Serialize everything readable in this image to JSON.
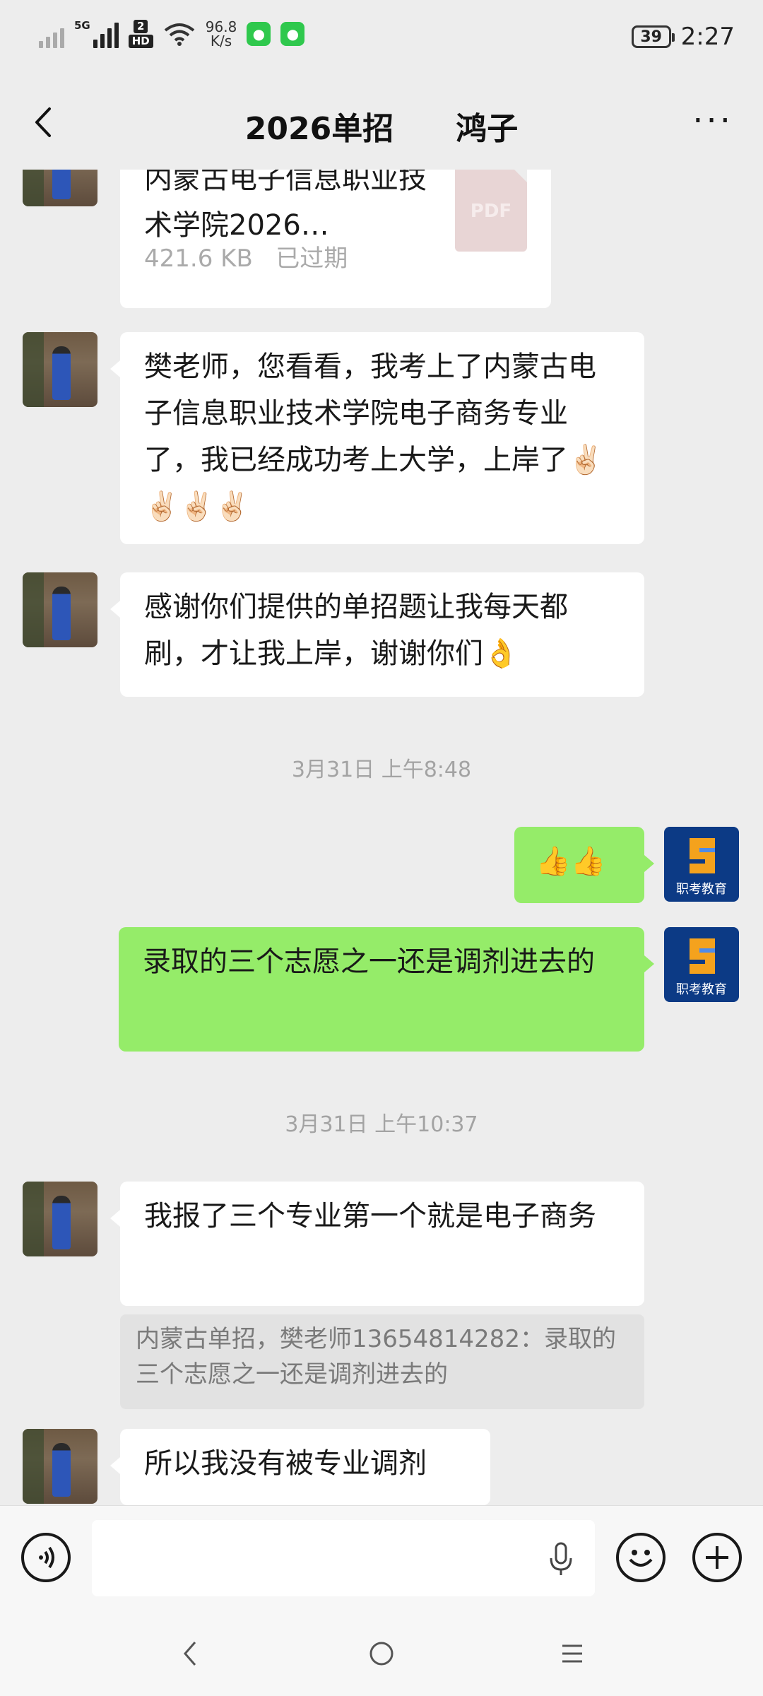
{
  "status_bar": {
    "network_label": "5G",
    "hd_top": "2",
    "hd_label": "HD",
    "speed_value": "96.8",
    "speed_unit": "K/s",
    "battery": "39",
    "time": "2:27"
  },
  "header": {
    "title": "2026单招　　鸿子",
    "back_icon": "chevron-left-icon",
    "more_icon": "more-dots-icon"
  },
  "messages": {
    "file": {
      "name": "内蒙古电子信息职业技术学院2026…",
      "size": "421.6 KB",
      "status": "已过期",
      "type_label": "PDF"
    },
    "msg1": "樊老师，您看看，我考上了内蒙古电子信息职业技术学院电子商务专业了，我已经成功考上大学，上岸了✌🏻✌🏻✌🏻✌🏻",
    "msg2": "感谢你们提供的单招题让我每天都刷，才让我上岸，谢谢你们👌",
    "time1": "3月31日 上午8:48",
    "sent1": "👍👍",
    "sent2": "录取的三个志愿之一还是调剂进去的",
    "time2": "3月31日 上午10:37",
    "msg3": "我报了三个专业第一个就是电子商务",
    "quote": "内蒙古单招，樊老师13654814282：录取的三个志愿之一还是调剂进去的",
    "msg4": "所以我没有被专业调剂",
    "brand_avatar_text": "职考教育"
  },
  "input_bar": {
    "voice_icon": "voice-icon",
    "mic_icon": "mic-icon",
    "emoji_icon": "emoji-icon",
    "plus_icon": "plus-icon"
  },
  "colors": {
    "background": "#ededed",
    "sent_bubble": "#95ec69",
    "received_bubble": "#ffffff",
    "brand_avatar": "#0c3a85"
  }
}
